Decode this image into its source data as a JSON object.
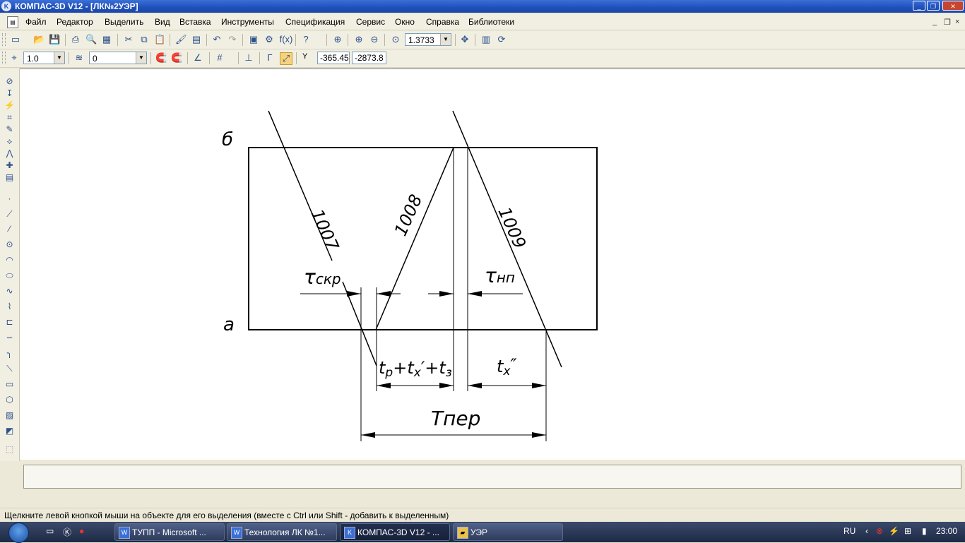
{
  "window": {
    "title": "КОМПАС-3D V12 - [ЛК№2УЭР]",
    "app_icon": "kompas-app-icon",
    "buttons": [
      "minimize-icon",
      "maximize-icon",
      "close-icon"
    ]
  },
  "menu": {
    "items": [
      "Файл",
      "Редактор",
      "Выделить",
      "Вид",
      "Вставка",
      "Инструменты",
      "Спецификация",
      "Сервис",
      "Окно",
      "Справка",
      "Библиотеки"
    ],
    "mdi_buttons": [
      "_",
      "❐",
      "×"
    ]
  },
  "toolbar1": {
    "zoom_value": "1.3733"
  },
  "toolbar2": {
    "style_value": "1.0",
    "layer_value": "0",
    "coord_label": "Y",
    "coord_x": "-365.45",
    "coord_y": "-2873.8"
  },
  "drawing": {
    "label_b": "б",
    "label_a": "а",
    "line_1007": "1007",
    "line_1008": "1008",
    "line_1009": "1009",
    "tau_skr_symbol": "τ",
    "tau_skr_sub": "скр",
    "tau_np_symbol": "τ",
    "tau_np_sub": "нп",
    "formula_parts": [
      "t",
      "р",
      "+t",
      "x",
      "′+t",
      "з"
    ],
    "tx_parts": [
      "t",
      "x",
      "″"
    ],
    "t_per": "Тпер"
  },
  "status": {
    "message": "Щелкните левой кнопкой мыши на объекте для его выделения (вместе с Ctrl или Shift - добавить к выделенным)"
  },
  "taskbar": {
    "tasks": [
      {
        "label": "ТУПП - Microsoft ...",
        "icon": "word-icon"
      },
      {
        "label": "Технология ЛК №1...",
        "icon": "word-icon"
      },
      {
        "label": "КОМПАС-3D V12 - ...",
        "icon": "kompas-icon"
      },
      {
        "label": "УЭР",
        "icon": "folder-icon"
      }
    ],
    "language": "RU",
    "clock": "23:00"
  }
}
